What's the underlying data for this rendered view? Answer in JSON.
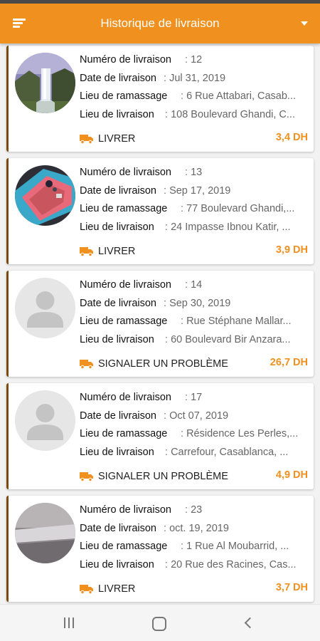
{
  "app_bar": {
    "title": "Historique de livraison",
    "menu_icon": "hamburger-menu-icon",
    "dropdown_icon": "caret-down-icon",
    "color": "#f0901e"
  },
  "labels": {
    "number": "Numéro de livraison",
    "date": "Date de livraison",
    "pickup": "Lieu de ramassage",
    "delivery": "Lieu de livraison",
    "separator": ":"
  },
  "deliveries": [
    {
      "number": "12",
      "date": "Jul 31, 2019",
      "pickup": "6 Rue Attabari, Casab...",
      "delivery": "108 Boulevard Ghandi, C...",
      "action": "LIVRER",
      "price": "3,4 DH",
      "avatar": "waterfall-photo"
    },
    {
      "number": "13",
      "date": "Sep 17, 2019",
      "pickup": "77 Boulevard Ghandi,...",
      "delivery": "24 Impasse Ibnou Katir, ...",
      "action": "LIVRER",
      "price": "3,9 DH",
      "avatar": "phone-photo"
    },
    {
      "number": "14",
      "date": "Sep 30, 2019",
      "pickup": "Rue Stéphane Mallar...",
      "delivery": "60 Boulevard Bir Anzara...",
      "action": "SIGNALER UN PROBLÈME",
      "price": "26,7 DH",
      "avatar": "default-user"
    },
    {
      "number": "17",
      "date": "Oct 07, 2019",
      "pickup": "Résidence Les Perles,...",
      "delivery": "Carrefour, Casablanca, ...",
      "action": "SIGNALER UN PROBLÈME",
      "price": "4,9 DH",
      "avatar": "default-user"
    },
    {
      "number": "23",
      "date": "oct. 19, 2019",
      "pickup": "1 Rue Al Moubarrid, ...",
      "delivery": "20 Rue des Racines, Cas...",
      "action": "LIVRER",
      "price": "3,7 DH",
      "avatar": "grey-photo"
    }
  ],
  "nav": {
    "recent_icon": "recent-apps-icon",
    "home_icon": "home-icon",
    "back_icon": "back-icon"
  }
}
